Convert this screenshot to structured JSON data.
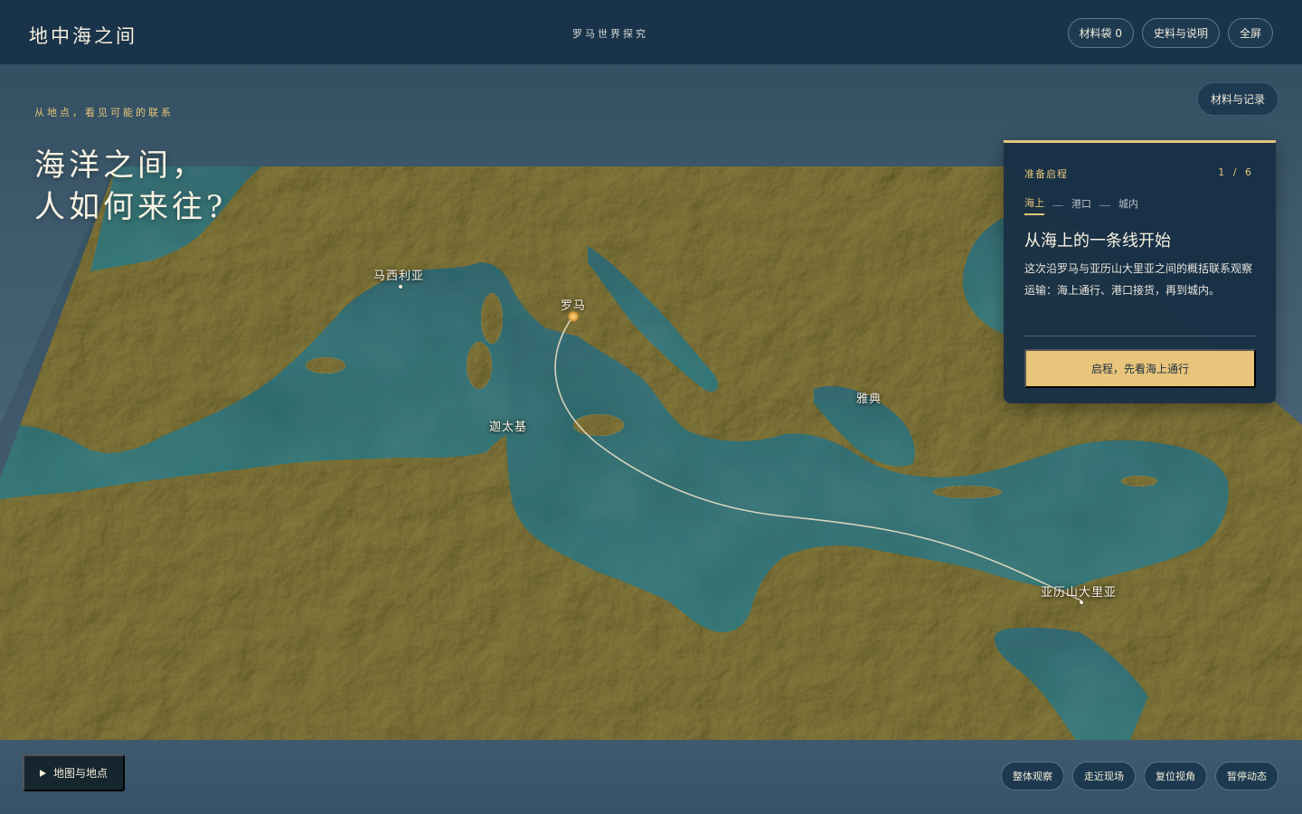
{
  "header": {
    "brand": "地中海之间",
    "subtitle": "罗马世界探究",
    "actions": [
      "材料袋 0",
      "史料与说明",
      "全屏"
    ]
  },
  "records_button": "材料与记录",
  "hero": {
    "kicker": "从地点，看见可能的联系",
    "headline_line1": "海洋之间，",
    "headline_line2": "人如何来往?"
  },
  "places": {
    "massilia": "马西利亚",
    "rome": "罗马",
    "carthage": "迦太基",
    "athens": "雅典",
    "alexandria": "亚历山大里亚"
  },
  "panel": {
    "status": "准备启程",
    "count": "1 / 6",
    "steps": [
      "海上",
      "港口",
      "城内"
    ],
    "active_step": "海上",
    "title": "从海上的一条线开始",
    "body": "这次沿罗马与亚历山大里亚之间的概括联系观察运输：海上通行、港口接货，再到城内。",
    "cta": "启程，先看海上通行"
  },
  "bottom": {
    "legend_toggle": "地图与地点",
    "view_actions": [
      "整体观察",
      "走近现场",
      "复位视角",
      "暂停动态"
    ]
  },
  "colors": {
    "land": "#a9a16c",
    "sea": "#2f6e6e",
    "accent": "#e8c57b",
    "panel": "#183046"
  }
}
